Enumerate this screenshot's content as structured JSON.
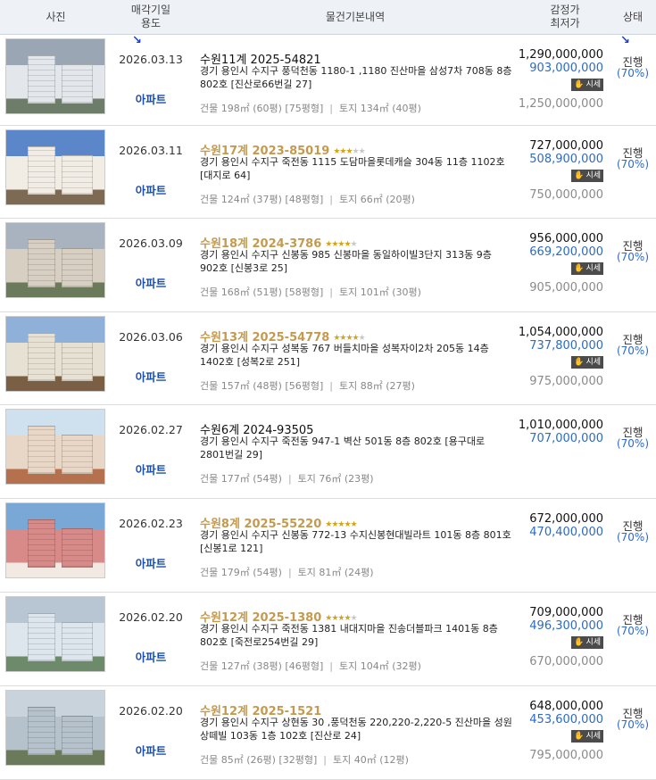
{
  "header": {
    "photo": "사진",
    "date_l1": "매각기일",
    "date_l2": "용도",
    "info": "물건기본내역",
    "price_l1": "감정가",
    "price_l2": "최저가",
    "status": "상태"
  },
  "rows": [
    {
      "date": "2026.03.13",
      "use": "아파트",
      "case": "수원11계 2025-54821",
      "gold": false,
      "stars": 0,
      "addr": "경기 용인시 수지구 풍덕천동 1180-1 ,1180 진산마을 삼성7차 708동 8층 802호 [진산로66번길 27]",
      "bldg": "건물 198㎡ (60평) [75평형]",
      "land": "토지 134㎡ (40평)",
      "appraisal": "1,290,000,000",
      "minimum": "903,000,000",
      "badge": "시세",
      "market": "1,250,000,000",
      "status": "진행",
      "ratio": "(70%)"
    },
    {
      "date": "2026.03.11",
      "use": "아파트",
      "case": "수원17계 2023-85019",
      "gold": true,
      "stars": 3,
      "addr": "경기 용인시 수지구 죽전동 1115 도담마을롯데캐슬 304동 11층 1102호 [대지로 64]",
      "bldg": "건물 124㎡ (37평) [48평형]",
      "land": "토지 66㎡ (20평)",
      "appraisal": "727,000,000",
      "minimum": "508,900,000",
      "badge": "시세",
      "market": "750,000,000",
      "status": "진행",
      "ratio": "(70%)"
    },
    {
      "date": "2026.03.09",
      "use": "아파트",
      "case": "수원18계 2024-3786",
      "gold": true,
      "stars": 4,
      "addr": "경기 용인시 수지구 신봉동 985 신봉마을 동일하이빌3단지 313동 9층 902호 [신봉3로 25]",
      "bldg": "건물 168㎡ (51평) [58평형]",
      "land": "토지 101㎡ (30평)",
      "appraisal": "956,000,000",
      "minimum": "669,200,000",
      "badge": "시세",
      "market": "905,000,000",
      "status": "진행",
      "ratio": "(70%)"
    },
    {
      "date": "2026.03.06",
      "use": "아파트",
      "case": "수원13계 2025-54778",
      "gold": true,
      "stars": 4,
      "addr": "경기 용인시 수지구 성복동 767 버들치마을 성복자이2차 205동 14층 1402호 [성복2로 251]",
      "bldg": "건물 157㎡ (48평) [56평형]",
      "land": "토지 88㎡ (27평)",
      "appraisal": "1,054,000,000",
      "minimum": "737,800,000",
      "badge": "시세",
      "market": "975,000,000",
      "status": "진행",
      "ratio": "(70%)"
    },
    {
      "date": "2026.02.27",
      "use": "아파트",
      "case": "수원6계 2024-93505",
      "gold": false,
      "stars": 0,
      "addr": "경기 용인시 수지구 죽전동 947-1 벽산 501동 8층 802호 [용구대로 2801번길 29]",
      "bldg": "건물 177㎡ (54평)",
      "land": "토지 76㎡ (23평)",
      "appraisal": "1,010,000,000",
      "minimum": "707,000,000",
      "badge": "",
      "market": "",
      "status": "진행",
      "ratio": "(70%)"
    },
    {
      "date": "2026.02.23",
      "use": "아파트",
      "case": "수원8계 2025-55220",
      "gold": true,
      "stars": 5,
      "addr": "경기 용인시 수지구 신봉동 772-13 수지신봉현대빌라트 101동 8층 801호 [신봉1로 121]",
      "bldg": "건물 179㎡ (54평)",
      "land": "토지 81㎡ (24평)",
      "appraisal": "672,000,000",
      "minimum": "470,400,000",
      "badge": "",
      "market": "",
      "status": "진행",
      "ratio": "(70%)"
    },
    {
      "date": "2026.02.20",
      "use": "아파트",
      "case": "수원12계 2025-1380",
      "gold": true,
      "stars": 4,
      "addr": "경기 용인시 수지구 죽전동 1381 내대지마을 진송더블파크 1401동 8층 802호 [죽전로254번길 29]",
      "bldg": "건물 127㎡ (38평) [46평형]",
      "land": "토지 104㎡ (32평)",
      "appraisal": "709,000,000",
      "minimum": "496,300,000",
      "badge": "시세",
      "market": "670,000,000",
      "status": "진행",
      "ratio": "(70%)"
    },
    {
      "date": "2026.02.20",
      "use": "아파트",
      "case": "수원12계 2025-1521",
      "gold": true,
      "stars": 0,
      "addr": "경기 용인시 수지구 상현동 30 ,풍덕천동 220,220-2,220-5 진산마을 성원상떼빌 103동 1층 102호 [진산로 24]",
      "bldg": "건물 85㎡ (26평) [32평형]",
      "land": "토지 40㎡ (12평)",
      "appraisal": "648,000,000",
      "minimum": "453,600,000",
      "badge": "시세",
      "market": "795,000,000",
      "status": "진행",
      "ratio": "(70%)"
    }
  ],
  "colors": {
    "header_bg": "#eef1f6",
    "gold_case": "#c59a4e",
    "blue_price": "#2c6bc4",
    "use_blue": "#1a4fb0"
  },
  "icons": {
    "badge_icon": "hand-coins-icon",
    "arrow_icon": "arrow-down-icon"
  }
}
